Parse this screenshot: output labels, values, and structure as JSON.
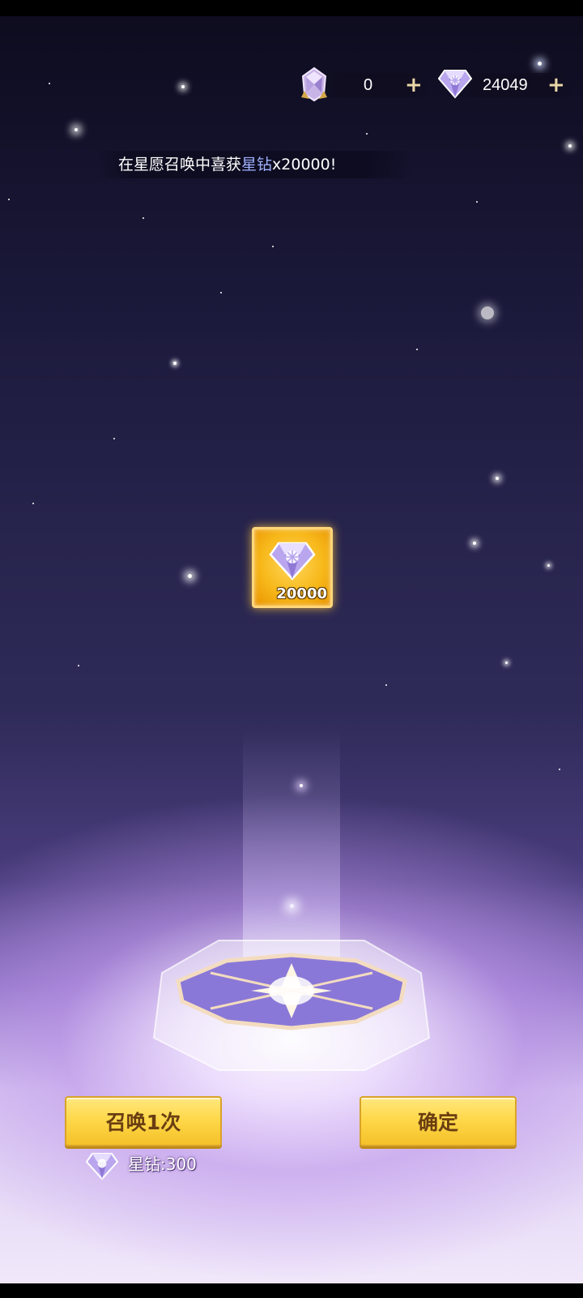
{
  "currency": {
    "crystal_count": "0",
    "diamond_count": "24049",
    "add_symbol": "+"
  },
  "notice": {
    "prefix": "在星愿召唤中喜获",
    "highlight": "星钻",
    "suffix": "x20000!"
  },
  "reward": {
    "item_icon": "star-diamond-icon",
    "count": "20000"
  },
  "actions": {
    "summon_label": "召唤1次",
    "confirm_label": "确定",
    "cost_label": "星钻:300"
  },
  "colors": {
    "highlight": "#9fb2ff",
    "button_gold": "#ffd84a",
    "button_text": "#6a3e12",
    "reward_frame": "#f7b81a"
  }
}
